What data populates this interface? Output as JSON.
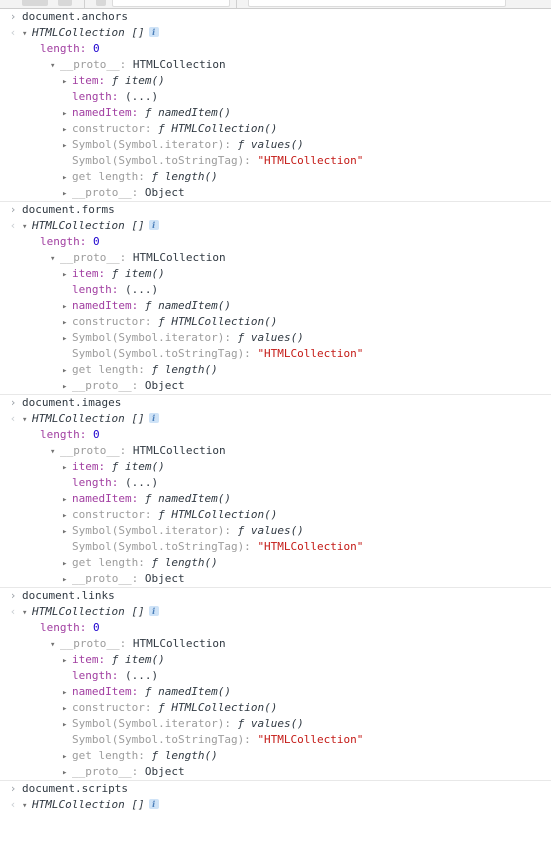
{
  "app": {
    "name": "devtools-console"
  },
  "toolbar": {
    "visible_sliver": true
  },
  "icons": {
    "prompt_arrow": "›",
    "result_arrow": "‹",
    "triangle_open": "▾",
    "triangle_closed": "▸",
    "info_badge": "i"
  },
  "labels": {
    "length_key": "length",
    "zero": "0",
    "proto_key": "__proto__",
    "htmlcollection": "HTMLCollection",
    "brackets": "[]",
    "colon": ":",
    "item_key": "item",
    "item_fn": "item()",
    "length_ellipsis": "(...)",
    "nameditem_key": "namedItem",
    "nameditem_fn": "namedItem()",
    "constructor_key": "constructor",
    "constructor_fn": "HTMLCollection()",
    "symbol_iterator_key": "Symbol(Symbol.iterator)",
    "symbol_iterator_fn": "values()",
    "symbol_tostringtag_key": "Symbol(Symbol.toStringTag)",
    "symbol_tostringtag_val": "\"HTMLCollection\"",
    "get_length_key": "get length",
    "get_length_fn": "length()",
    "object": "Object",
    "fn_marker": "ƒ"
  },
  "colors": {
    "background": "#ffffff",
    "text": "#303942",
    "property_name": "#a13ea1",
    "non_enumerable": "#9c9c9c",
    "number": "#1c00cf",
    "string": "#c41a16",
    "divider": "#e8e8e8",
    "info_badge_bg": "#cfe3f7",
    "info_badge_fg": "#4b7fba"
  },
  "groups": [
    {
      "command": "document.anchors",
      "result_type": "HTMLCollection",
      "result_preview": "[]",
      "length": "0",
      "truncated": false
    },
    {
      "command": "document.forms",
      "result_type": "HTMLCollection",
      "result_preview": "[]",
      "length": "0",
      "truncated": false
    },
    {
      "command": "document.images",
      "result_type": "HTMLCollection",
      "result_preview": "[]",
      "length": "0",
      "truncated": false
    },
    {
      "command": "document.links",
      "result_type": "HTMLCollection",
      "result_preview": "[]",
      "length": "0",
      "truncated": false
    },
    {
      "command": "document.scripts",
      "result_type": "HTMLCollection",
      "result_preview": "[]",
      "length": "0",
      "truncated": true
    }
  ]
}
